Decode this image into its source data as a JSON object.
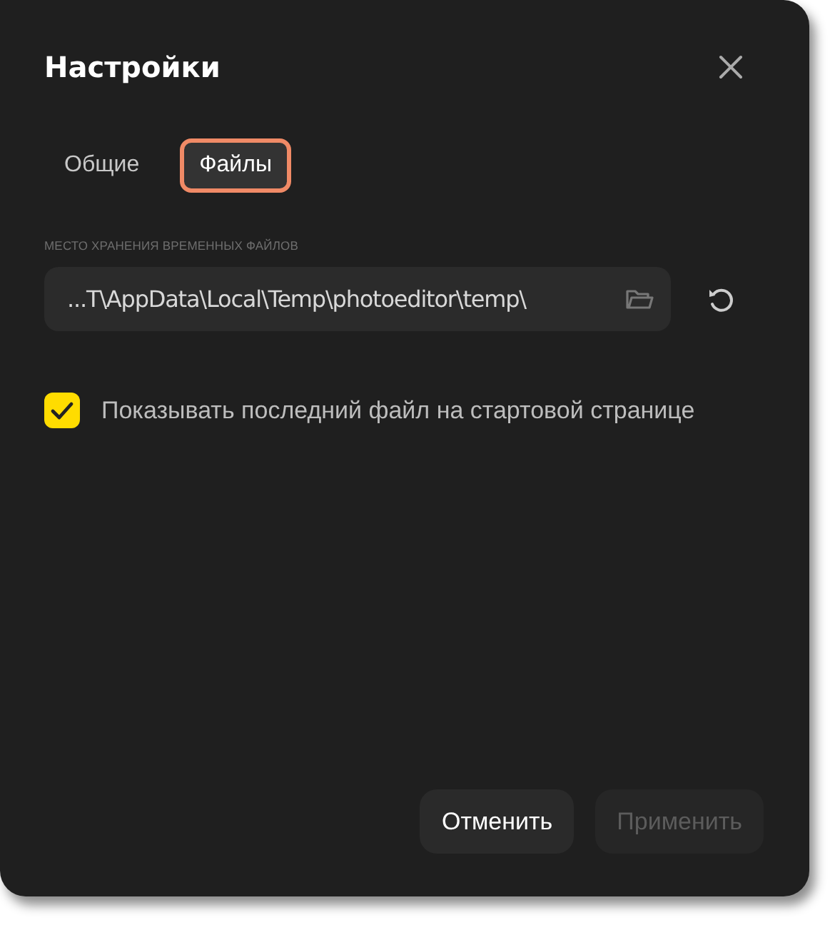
{
  "dialog": {
    "title": "Настройки"
  },
  "tabs": [
    {
      "label": "Общие",
      "selected": false
    },
    {
      "label": "Файлы",
      "selected": true
    }
  ],
  "temp_folder": {
    "label": "МЕСТО ХРАНЕНИЯ ВРЕМЕННЫХ ФАЙЛОВ",
    "value": "...T\\AppData\\Local\\Temp\\photoeditor\\temp\\"
  },
  "options": [
    {
      "label": "Показывать последний файл на стартовой странице",
      "checked": true
    }
  ],
  "buttons": [
    {
      "label": "Отменить",
      "disabled": false
    },
    {
      "label": "Применить",
      "disabled": true
    }
  ]
}
